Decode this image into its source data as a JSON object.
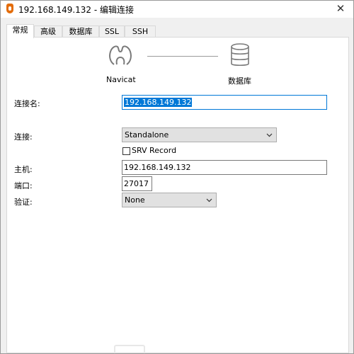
{
  "window": {
    "title": "192.168.149.132 - 编辑连接",
    "close_glyph": "✕",
    "app_icon": "navicat-app-icon"
  },
  "tabs": [
    {
      "label": "常规",
      "active": true
    },
    {
      "label": "高级",
      "active": false
    },
    {
      "label": "数据库",
      "active": false
    },
    {
      "label": "SSL",
      "active": false
    },
    {
      "label": "SSH",
      "active": false
    }
  ],
  "diagram": {
    "left_label": "Navicat",
    "right_label": "数据库",
    "left_icon": "navicat-icon",
    "right_icon": "database-icon"
  },
  "form": {
    "connection_name_label": "连接名:",
    "connection_name_value": "192.168.149.132",
    "connection_label": "连接:",
    "connection_value": "Standalone",
    "srv_record_label": "SRV Record",
    "srv_record_checked": false,
    "host_label": "主机:",
    "host_value": "192.168.149.132",
    "port_label": "端口:",
    "port_value": "27017",
    "auth_label": "验证:",
    "auth_value": "None"
  },
  "colors": {
    "selection": "#0078d7",
    "focus_border": "#0078d7",
    "app_icon": "#e36c0a"
  }
}
